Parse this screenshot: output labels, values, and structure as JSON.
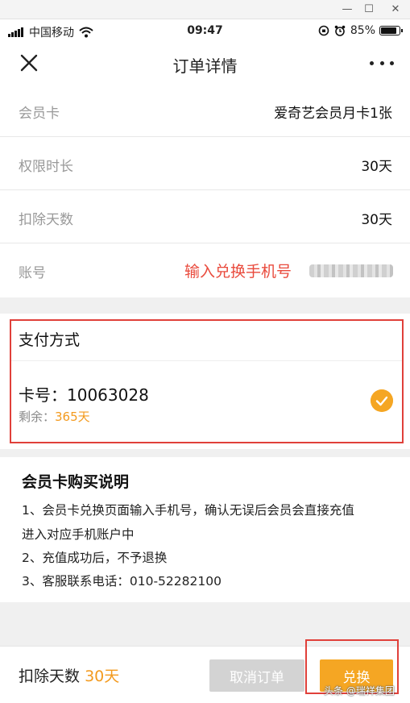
{
  "window": {
    "minimize": "—",
    "maximize": "☐",
    "close": "✕"
  },
  "status_bar": {
    "carrier": "中国移动",
    "time": "09:47",
    "battery": "85%"
  },
  "nav": {
    "title": "订单详情"
  },
  "rows": [
    {
      "label": "会员卡",
      "value": "爱奇艺会员月卡1张"
    },
    {
      "label": "权限时长",
      "value": "30天"
    },
    {
      "label": "扣除天数",
      "value": "30天"
    },
    {
      "label": "账号",
      "value": "输入兑换手机号"
    }
  ],
  "payment": {
    "title": "支付方式",
    "card_number": "卡号：10063028",
    "remain_label": "剩余：",
    "remain_value": "365天"
  },
  "description": {
    "title": "会员卡购买说明",
    "lines": [
      "1、会员卡兑换页面输入手机号，确认无误后会员会直接充值",
      "进入对应手机账户中",
      "2、充值成功后，不予退换",
      "3、客服联系电话：010-52282100"
    ]
  },
  "bottom_bar": {
    "deduct_label": "扣除天数",
    "deduct_value": "30天",
    "cancel_label": "取消订单",
    "redeem_label": "兑换"
  },
  "watermark": "头条 @瑞祥集团",
  "colors": {
    "accent": "#f5a623",
    "highlight_red": "#e0403a",
    "muted": "#999999"
  },
  "icons": [
    "close-icon",
    "more-icon",
    "wifi-icon",
    "signal-icon",
    "alarm-icon",
    "battery-icon",
    "checkmark-icon"
  ]
}
